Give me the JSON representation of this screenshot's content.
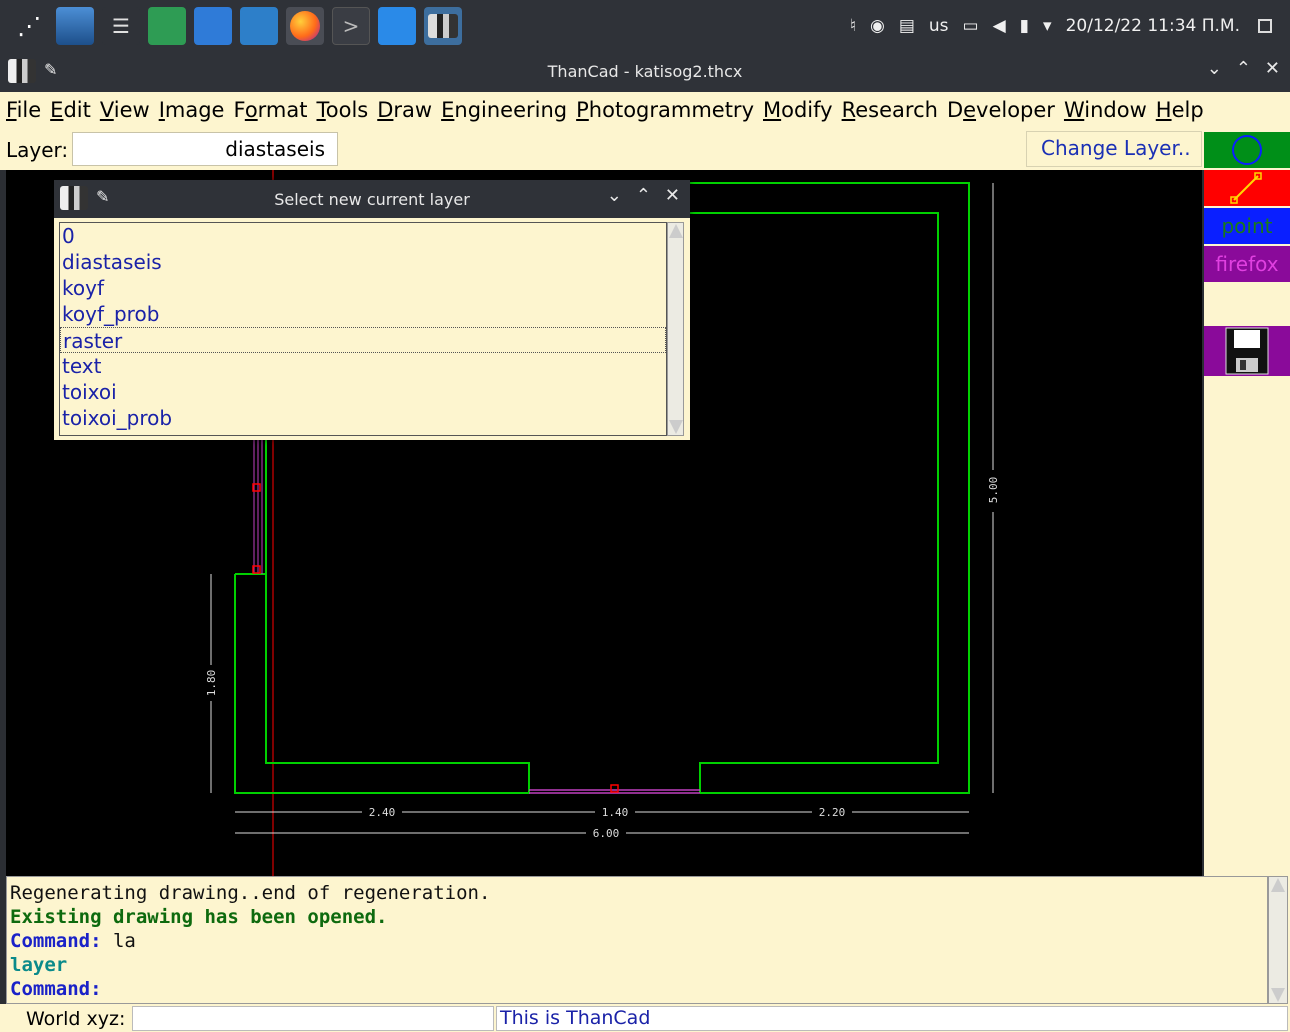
{
  "taskbar": {
    "tray": {
      "keyboard": "us",
      "datetime": "20/12/22 11:34 Π.Μ."
    }
  },
  "window": {
    "title": "ThanCad - katisog2.thcx"
  },
  "menu": [
    "File",
    "Edit",
    "View",
    "Image",
    "Format",
    "Tools",
    "Draw",
    "Engineering",
    "Photogrammetry",
    "Modify",
    "Research",
    "Developer",
    "Window",
    "Help"
  ],
  "menu_underline": [
    "F",
    "E",
    "V",
    "I",
    "o",
    "T",
    "D",
    "E",
    "P",
    "M",
    "R",
    "e",
    "W",
    "H"
  ],
  "layerbar": {
    "label": "Layer:",
    "current": "diastaseis",
    "change_button": "Change Layer.."
  },
  "righttools": {
    "point": "point",
    "firefox": "firefox"
  },
  "colors": {
    "cream": "#fdf5cf",
    "green_tool": "#008f18",
    "red_tool": "#ff0000",
    "blue_tool": "#0a1fff",
    "purple_tool": "#8a0a9a",
    "drawing_green": "#00d000"
  },
  "dialog": {
    "title": "Select new current layer",
    "layers": [
      "0",
      "diastaseis",
      "koyf",
      "koyf_prob",
      "raster",
      "text",
      "toixoi",
      "toixoi_prob"
    ],
    "selected_index": 4
  },
  "drawing": {
    "dims": {
      "d240": "2.40",
      "d140": "1.40",
      "d220": "2.20",
      "d600": "6.00",
      "d500": "5.00",
      "d180": "1.80"
    }
  },
  "console": {
    "line1": "Regenerating drawing..end of regeneration.",
    "line2": "Existing drawing has been opened.",
    "line3_label": "Command:",
    "line3_value": " la",
    "line4": "layer",
    "line5_label": "Command:"
  },
  "status": {
    "world_label": "World xyz:",
    "message": "This is ThanCad"
  }
}
